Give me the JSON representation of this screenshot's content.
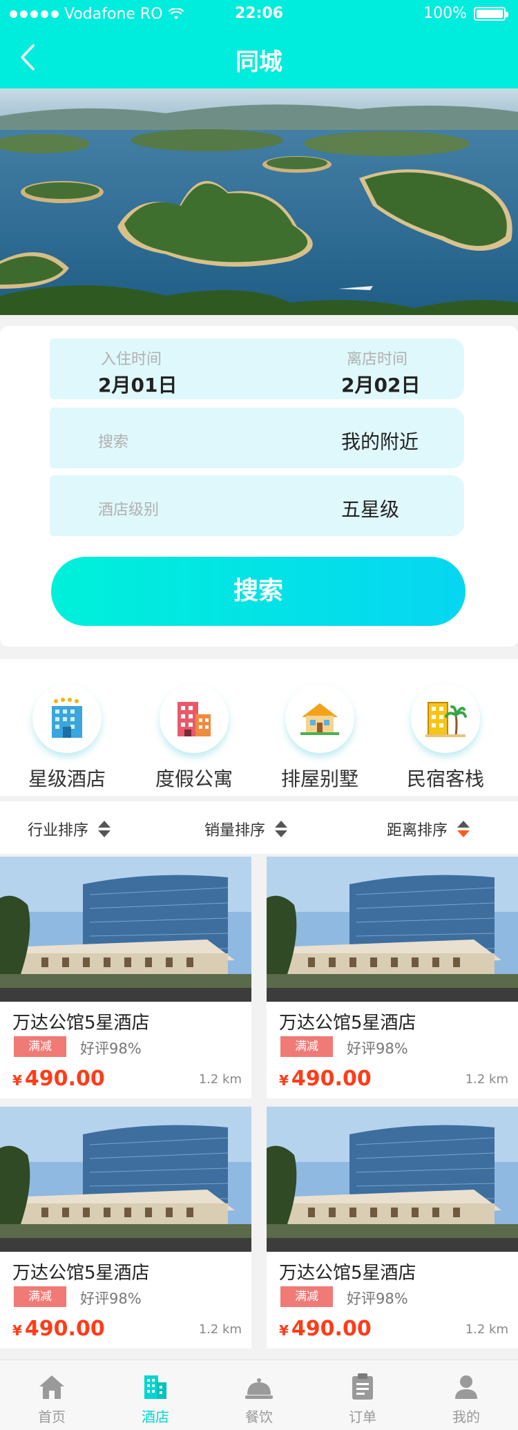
{
  "status": {
    "carrier": "Vodafone RO",
    "time": "22:06",
    "battery": "100%"
  },
  "nav": {
    "title": "同城"
  },
  "form": {
    "checkin_label": "入住时间",
    "checkin_value": "2月01日",
    "checkout_label": "离店时间",
    "checkout_value": "2月02日",
    "search_placeholder": "搜索",
    "nearby": "我的附近",
    "level_label": "酒店级别",
    "level_value": "五星级",
    "search_button": "搜索"
  },
  "categories": [
    {
      "label": "星级酒店",
      "icon": "hotel-building-icon"
    },
    {
      "label": "度假公寓",
      "icon": "apartment-icon"
    },
    {
      "label": "排屋别墅",
      "icon": "villa-icon"
    },
    {
      "label": "民宿客栈",
      "icon": "inn-palm-icon"
    }
  ],
  "sort": [
    {
      "label": "行业排序",
      "active": false
    },
    {
      "label": "销量排序",
      "active": false
    },
    {
      "label": "距离排序",
      "active": true
    }
  ],
  "hotels": [
    {
      "name": "万达公馆5星酒店",
      "tag": "满减",
      "rating": "好评98%",
      "currency": "¥",
      "price": "490.00",
      "distance": "1.2 km"
    },
    {
      "name": "万达公馆5星酒店",
      "tag": "满减",
      "rating": "好评98%",
      "currency": "¥",
      "price": "490.00",
      "distance": "1.2 km"
    },
    {
      "name": "万达公馆5星酒店",
      "tag": "满减",
      "rating": "好评98%",
      "currency": "¥",
      "price": "490.00",
      "distance": "1.2 km"
    },
    {
      "name": "万达公馆5星酒店",
      "tag": "满减",
      "rating": "好评98%",
      "currency": "¥",
      "price": "490.00",
      "distance": "1.2 km"
    }
  ],
  "tabs": [
    {
      "label": "首页",
      "icon": "home-icon",
      "active": false
    },
    {
      "label": "酒店",
      "icon": "hotel-icon",
      "active": true
    },
    {
      "label": "餐饮",
      "icon": "dining-bell-icon",
      "active": false
    },
    {
      "label": "订单",
      "icon": "order-clipboard-icon",
      "active": false
    },
    {
      "label": "我的",
      "icon": "profile-icon",
      "active": false
    }
  ],
  "colors": {
    "accent": "#00ecdd",
    "price": "#ff3c18",
    "tag": "#f07a76",
    "sort_active": "#ff5a1f"
  }
}
